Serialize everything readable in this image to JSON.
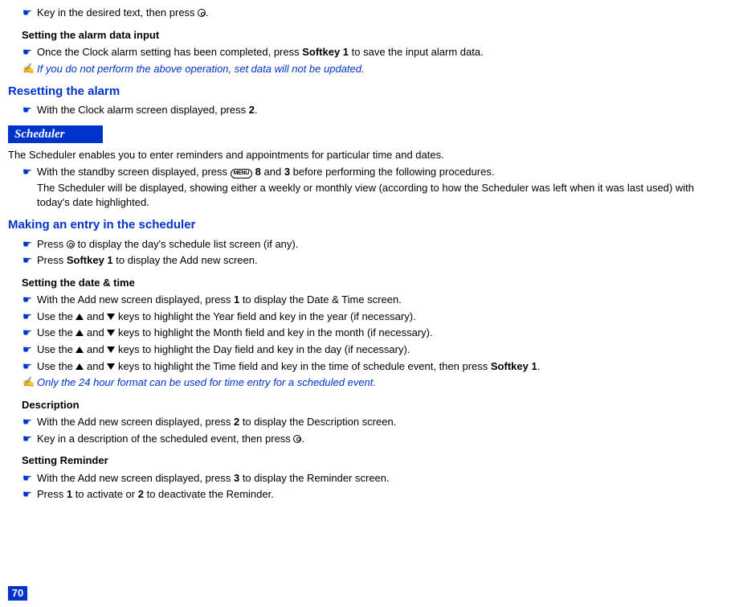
{
  "line1_a": "Key in the desired text, then press ",
  "line1_b": ".",
  "h3_alarm_data": "Setting the alarm data input",
  "line2_a": "Once the Clock alarm setting has been completed, press ",
  "line2_sk1": "Softkey 1",
  "line2_b": " to save the input alarm data.",
  "note1": "If you do not perform the above operation, set data will not be updated.",
  "h2_reset": "Resetting the alarm",
  "line3_a": "With the Clock alarm screen displayed, press ",
  "line3_b2": "2",
  "line3_c": ".",
  "section_scheduler": "Scheduler",
  "intro": "The Scheduler enables you to enter reminders and appointments for particular time and dates.",
  "line4_a": "With the standby screen displayed, press ",
  "menu_label": "MENU",
  "line4_b": " ",
  "line4_n8": "8",
  "line4_c": " and ",
  "line4_n3": "3",
  "line4_d": " before performing the following procedures.",
  "line4_sub": "The Scheduler will be displayed, showing either a weekly or monthly view (according to how the Scheduler was left when it was last used) with today's date highlighted.",
  "h2_entry": "Making an entry in the scheduler",
  "line5_a": "Press ",
  "line5_b": " to display the day's schedule list screen (if any).",
  "line6_a": "Press ",
  "line6_sk1": "Softkey 1",
  "line6_b": " to display the Add new screen.",
  "h3_datetime": "Setting the date & time",
  "line7_a": "With the Add new screen displayed, press ",
  "line7_n1": "1",
  "line7_b": " to display the Date & Time screen.",
  "line8_a": "Use the ",
  "line8_b": " and ",
  "line8_c": " keys to highlight the Year field and key in the year (if necessary).",
  "line9_a": "Use the ",
  "line9_b": " and ",
  "line9_c": " keys to highlight the Month field and key in the month (if necessary).",
  "line10_a": "Use the ",
  "line10_b": " and ",
  "line10_c": " keys to highlight the Day field and key in the day (if necessary).",
  "line11_a": "Use the ",
  "line11_b": " and ",
  "line11_c": " keys to highlight the Time field and key in the time of schedule event, then press ",
  "line11_sk1": "Softkey 1",
  "line11_d": ".",
  "note2": "Only the 24 hour format can be used for time entry for a scheduled event.",
  "h3_desc": "Description",
  "line12_a": "With the Add new screen displayed, press ",
  "line12_n2": "2",
  "line12_b": " to display the Description screen.",
  "line13_a": "Key in a description of the scheduled event, then press ",
  "line13_b": ".",
  "h3_reminder": "Setting Reminder",
  "line14_a": "With the Add new screen displayed, press ",
  "line14_n3": "3",
  "line14_b": " to display the Reminder screen.",
  "line15_a": "Press ",
  "line15_n1": "1",
  "line15_b": " to activate or ",
  "line15_n2": "2",
  "line15_c": " to deactivate the Reminder.",
  "page": "70"
}
